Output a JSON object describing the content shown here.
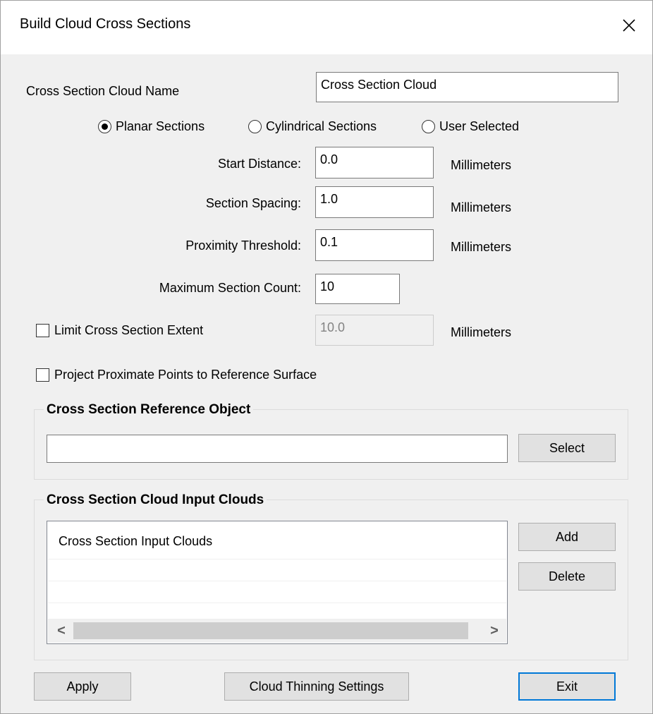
{
  "window": {
    "title": "Build Cloud Cross Sections",
    "close_icon": "close-icon"
  },
  "cloud_name": {
    "label": "Cross Section Cloud Name",
    "value": "Cross Section Cloud"
  },
  "section_type": {
    "options": [
      {
        "label": "Planar Sections",
        "selected": true
      },
      {
        "label": "Cylindrical Sections",
        "selected": false
      },
      {
        "label": "User Selected",
        "selected": false
      }
    ]
  },
  "parameters": {
    "start_distance": {
      "label": "Start Distance:",
      "value": "0.0",
      "unit": "Millimeters"
    },
    "section_spacing": {
      "label": "Section Spacing:",
      "value": "1.0",
      "unit": "Millimeters"
    },
    "proximity_threshold": {
      "label": "Proximity Threshold:",
      "value": "0.1",
      "unit": "Millimeters"
    },
    "max_section_count": {
      "label": "Maximum Section Count:",
      "value": "10"
    }
  },
  "limit_extent": {
    "label": "Limit Cross Section Extent",
    "checked": false,
    "value": "10.0",
    "unit": "Millimeters"
  },
  "project_points": {
    "label": "Project Proximate Points to Reference Surface",
    "checked": false
  },
  "reference_object": {
    "title": "Cross Section Reference Object",
    "value": "",
    "select_label": "Select"
  },
  "input_clouds": {
    "title": "Cross Section Cloud Input Clouds",
    "items": [
      "Cross Section Input Clouds"
    ],
    "add_label": "Add",
    "delete_label": "Delete",
    "scroll_left": "<",
    "scroll_right": ">"
  },
  "footer": {
    "apply_label": "Apply",
    "thinning_label": "Cloud Thinning Settings",
    "exit_label": "Exit"
  },
  "colors": {
    "accent": "#0078d7",
    "dialog_bg": "#f0f0f0",
    "button_bg": "#e1e1e1"
  }
}
